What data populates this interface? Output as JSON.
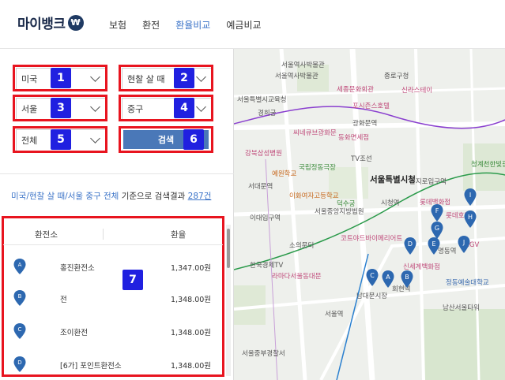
{
  "header": {
    "logo": "마이뱅크",
    "logo_symbol": "₩",
    "nav": [
      "보험",
      "환전",
      "환율비교",
      "예금비교"
    ],
    "active_nav": "환율비교"
  },
  "filters": {
    "country": "미국",
    "type": "현찰 살 때",
    "city": "서울",
    "district": "중구",
    "scope": "전체",
    "search_label": "검색"
  },
  "annotations": [
    "1",
    "2",
    "3",
    "4",
    "5",
    "6",
    "7"
  ],
  "result": {
    "query_text": "미국/현찰 살 때/서울 중구 전체",
    "suffix": " 기준으로 검색결과 ",
    "count": "287건"
  },
  "table": {
    "headers": [
      "환전소",
      "환율"
    ],
    "rows": [
      {
        "marker": "A",
        "name": "홍진환전소",
        "rate": "1,347.00원"
      },
      {
        "marker": "B",
        "name": "전",
        "rate": "1,348.00원"
      },
      {
        "marker": "C",
        "name": "조이환전",
        "rate": "1,348.00원"
      },
      {
        "marker": "D",
        "name": "[6가] 포인트환전소",
        "rate": "1,348.00원"
      }
    ]
  },
  "map": {
    "labels": [
      {
        "t": "서울특별시청",
        "cls": "big"
      },
      {
        "t": "종로구청",
        "cls": ""
      },
      {
        "t": "서울역사박물관",
        "cls": ""
      },
      {
        "t": "경희궁",
        "cls": ""
      },
      {
        "t": "세종문화회관",
        "cls": "pink"
      },
      {
        "t": "신라스테이",
        "cls": "pink"
      },
      {
        "t": "광화문역",
        "cls": ""
      },
      {
        "t": "포시즌스호텔",
        "cls": "pink"
      },
      {
        "t": "씨네큐브광화문",
        "cls": "pink"
      },
      {
        "t": "강북삼성병원",
        "cls": "pink"
      },
      {
        "t": "동화면세점",
        "cls": "pink"
      },
      {
        "t": "TV조선",
        "cls": ""
      },
      {
        "t": "국립정동극장",
        "cls": "green"
      },
      {
        "t": "예원학교",
        "cls": "orange"
      },
      {
        "t": "이화여자고등학교",
        "cls": "orange"
      },
      {
        "t": "서대문역",
        "cls": ""
      },
      {
        "t": "덕수궁",
        "cls": "green"
      },
      {
        "t": "시청역",
        "cls": ""
      },
      {
        "t": "서울중앙지방법원",
        "cls": ""
      },
      {
        "t": "이대입구역",
        "cls": ""
      },
      {
        "t": "소의문터",
        "cls": ""
      },
      {
        "t": "코트야드바이메리어트",
        "cls": "pink"
      },
      {
        "t": "서울역",
        "cls": ""
      },
      {
        "t": "한국경제TV",
        "cls": ""
      },
      {
        "t": "라마다서울동대문",
        "cls": "pink"
      },
      {
        "t": "롯데백화점",
        "cls": "pink"
      },
      {
        "t": "명동역",
        "cls": ""
      },
      {
        "t": "신세계백화점",
        "cls": "pink"
      },
      {
        "t": "남대문시장",
        "cls": ""
      },
      {
        "t": "회현역",
        "cls": ""
      },
      {
        "t": "남산서울타워",
        "cls": ""
      },
      {
        "t": "정동예술대학교",
        "cls": "blue"
      },
      {
        "t": "청계천한빛광장",
        "cls": "green"
      },
      {
        "t": "서울특별시교육청",
        "cls": ""
      },
      {
        "t": "서울역사박물관",
        "cls": ""
      },
      {
        "t": "을지로입구역",
        "cls": ""
      },
      {
        "t": "롯데호텔",
        "cls": "pink"
      },
      {
        "t": "서울중부경찰서",
        "cls": ""
      },
      {
        "t": "CGV",
        "cls": "pink"
      }
    ],
    "pins": [
      "A",
      "B",
      "C",
      "D",
      "E",
      "F",
      "G",
      "H",
      "I",
      "J"
    ]
  },
  "colors": {
    "annotation_box": "#e8141f",
    "annotation_badge": "#2020e0",
    "search_button": "#4a78b8",
    "accent": "#3c74c8",
    "marker": "#2d68b0"
  }
}
